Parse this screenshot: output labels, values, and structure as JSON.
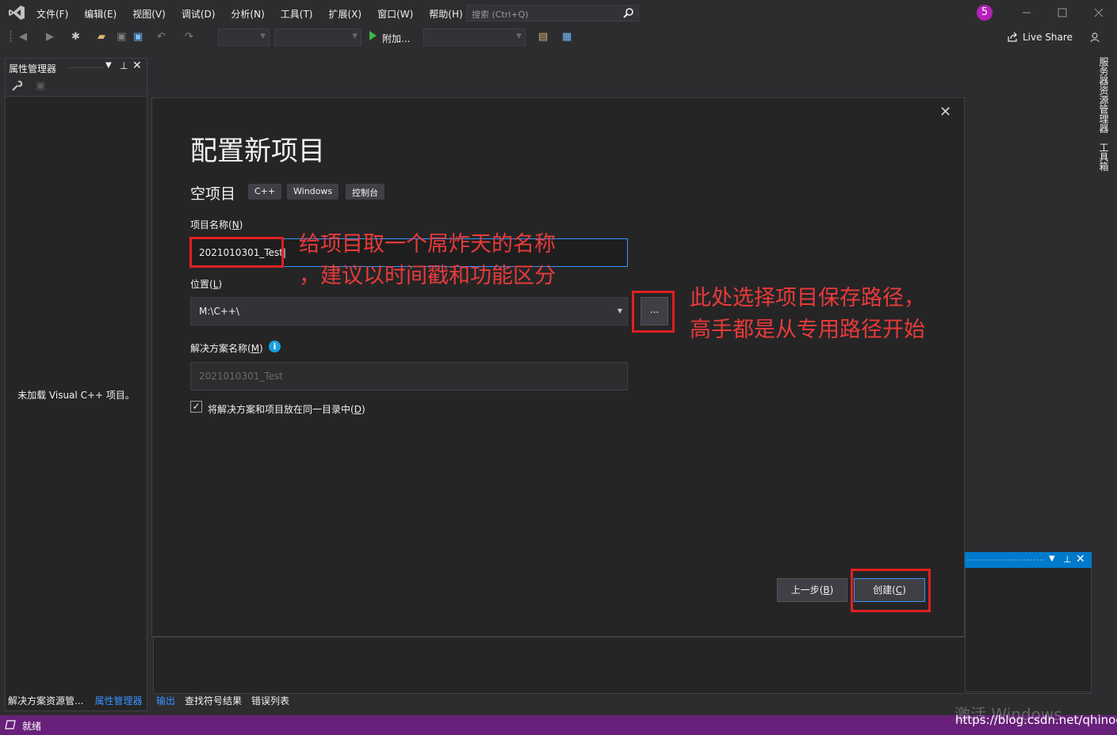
{
  "menubar": {
    "items": [
      "文件(F)",
      "编辑(E)",
      "视图(V)",
      "调试(D)",
      "分析(N)",
      "工具(T)",
      "扩展(X)",
      "窗口(W)",
      "帮助(H)"
    ],
    "search_placeholder": "搜索 (Ctrl+Q)",
    "notification_count": "5"
  },
  "toolbar": {
    "attach_label": "附加...",
    "live_share_label": "Live Share"
  },
  "left_panel": {
    "title": "属性管理器",
    "empty_message": "未加载 Visual C++ 项目。",
    "tabs": [
      "解决方案资源管...",
      "属性管理器"
    ]
  },
  "right_sidebar": {
    "tabs": [
      "服务器资源管理器",
      "工具箱"
    ]
  },
  "dialog": {
    "title": "配置新项目",
    "template_name": "空项目",
    "tags": [
      "C++",
      "Windows",
      "控制台"
    ],
    "project_name_label": "项目名称(",
    "project_name_hotkey": "N",
    "project_name_value": "2021010301_Test",
    "location_label": "位置(",
    "location_hotkey": "L",
    "location_value": "M:\\C++\\",
    "browse_label": "...",
    "solution_label": "解决方案名称(",
    "solution_hotkey": "M",
    "solution_value": "2021010301_Test",
    "checkbox_label": "将解决方案和项目放在同一目录中(",
    "checkbox_hotkey": "D",
    "checkbox_checked": true,
    "back_label": "上一步(",
    "back_hotkey": "B",
    "create_label": "创建(",
    "create_hotkey": "C"
  },
  "annotations": {
    "name_note_line1": "给项目取一个屌炸天的名称",
    "name_note_line2": "，建议以时间戳和功能区分",
    "path_note_line1": "此处选择项目保存路径，",
    "path_note_line2": "高手都是从专用路径开始"
  },
  "bottom_tabs": [
    "输出",
    "查找符号结果",
    "错误列表"
  ],
  "statusbar": {
    "text": "就绪"
  },
  "watermark": {
    "activate": "激活 Windows",
    "url": "https://blog.csdn.net/qhinoo"
  },
  "colors": {
    "accent": "#007acc",
    "statusbar": "#68217a",
    "annotation": "#e02020"
  }
}
